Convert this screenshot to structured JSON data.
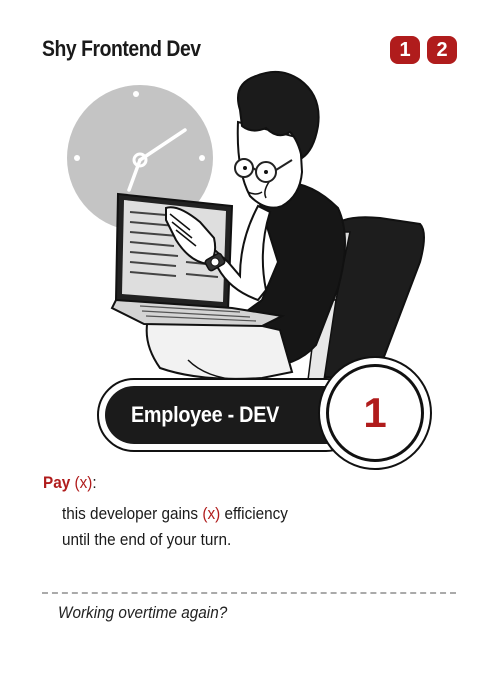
{
  "card": {
    "title": "Shy Frontend Dev",
    "badges": [
      "1",
      "2"
    ],
    "role": "Employee - DEV",
    "cost": "1",
    "ability": {
      "pay_word": "Pay",
      "pay_x": "(x)",
      "pay_colon": ":",
      "line2_start": "this developer gains ",
      "line2_x": "(x)",
      "line2_end": " efficiency",
      "line3": "until the end of your turn."
    },
    "flavor": "Working overtime again?"
  },
  "colors": {
    "accent_red": "#b01c1c",
    "banner_dark": "#1b1b1b",
    "clock_gray": "#c4c4c4",
    "divider_gray": "#aaaaaa"
  }
}
